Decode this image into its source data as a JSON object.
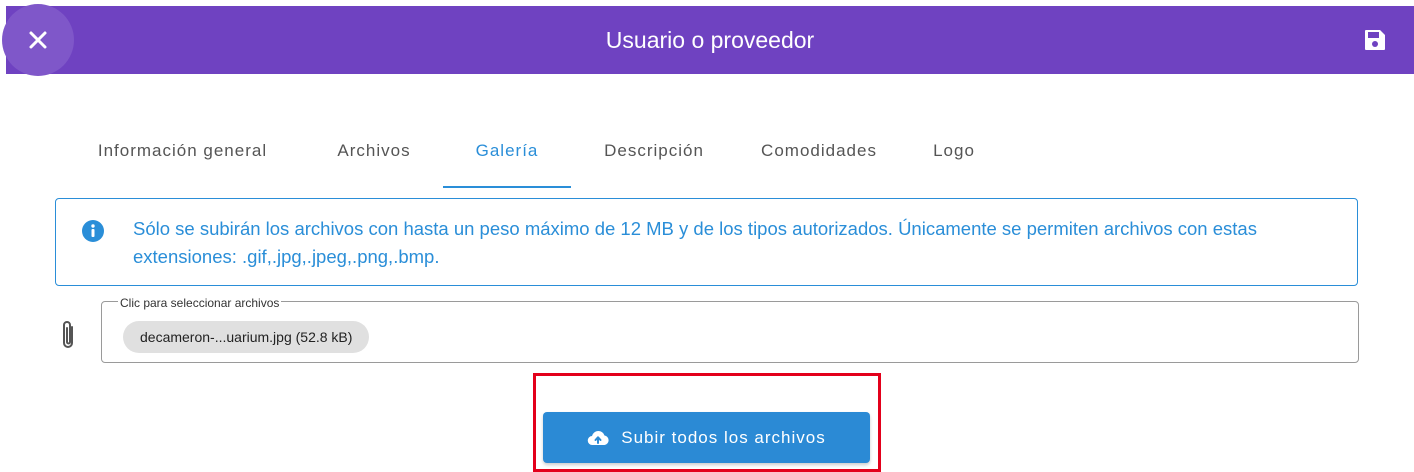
{
  "header": {
    "title": "Usuario o proveedor",
    "close_icon": "close-icon",
    "save_icon": "save-icon",
    "background_color": "#6f42c1"
  },
  "tabs": [
    {
      "label": "Información general",
      "active": false
    },
    {
      "label": "Archivos",
      "active": false
    },
    {
      "label": "Galería",
      "active": true
    },
    {
      "label": "Descripción",
      "active": false
    },
    {
      "label": "Comodidades",
      "active": false
    },
    {
      "label": "Logo",
      "active": false
    }
  ],
  "info": {
    "icon": "info-icon",
    "text": "Sólo se subirán los archivos con hasta un peso máximo de 12 MB y de los tipos autorizados. Únicamente se permiten archivos con estas extensiones: .gif,.jpg,.jpeg,.png,.bmp.",
    "color": "#2a8ed8"
  },
  "file_field": {
    "icon": "paperclip-icon",
    "label": "Clic para seleccionar archivos",
    "files": [
      {
        "chip_text": "decameron-...uarium.jpg (52.8 kB)"
      }
    ]
  },
  "upload_button": {
    "label": "Subir todos los archivos",
    "icon": "cloud-upload-icon",
    "color": "#2b8ad5"
  },
  "highlight_color": "#e3001b"
}
